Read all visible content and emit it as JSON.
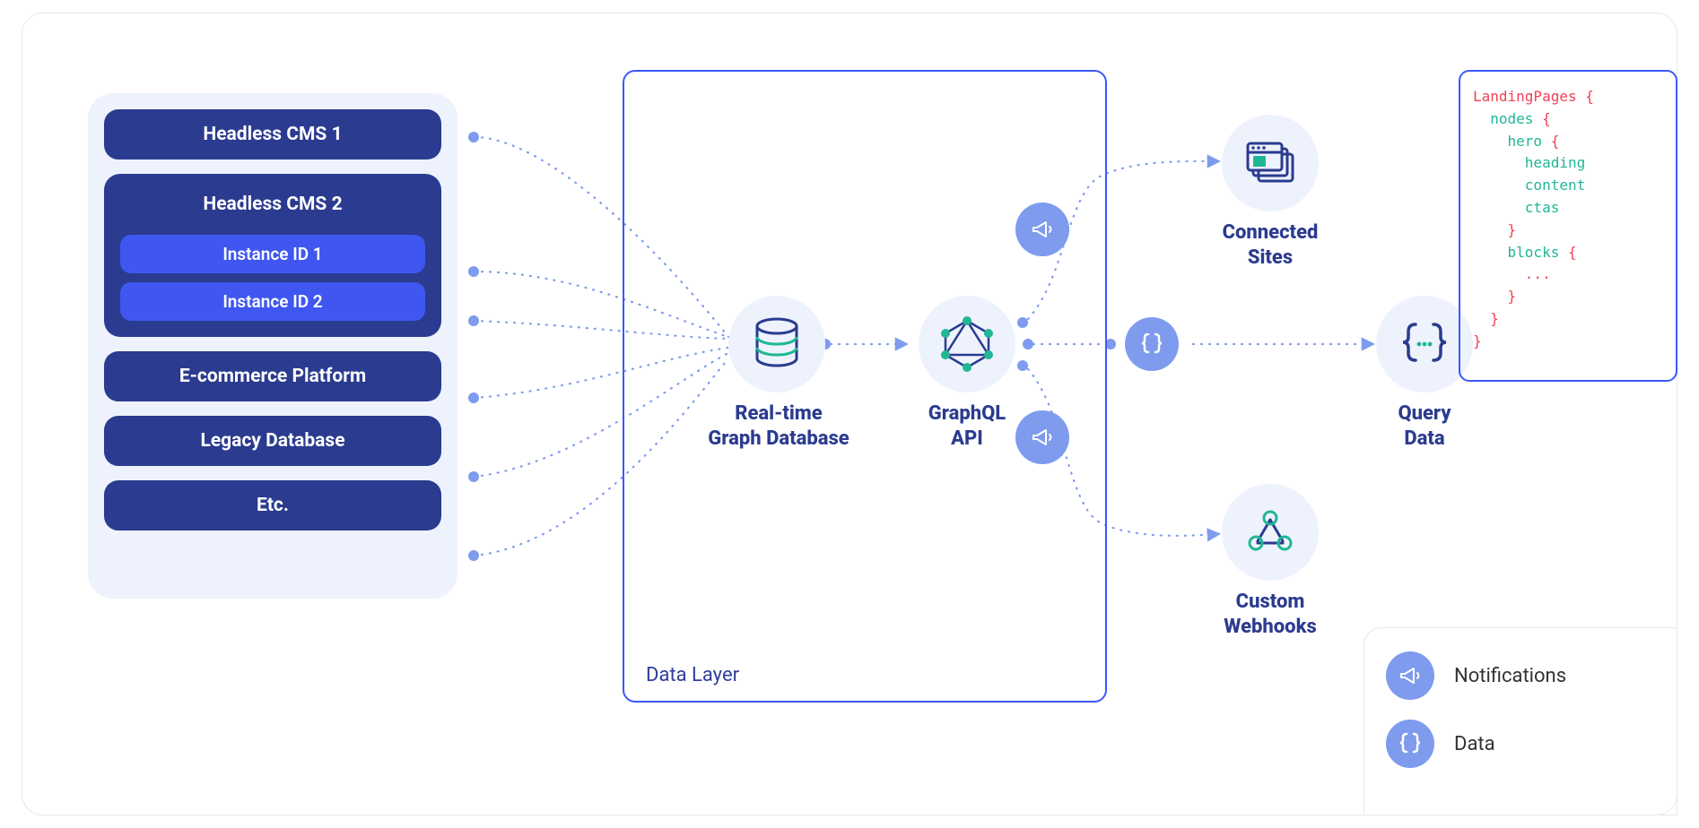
{
  "sources": {
    "items": [
      {
        "label": "Headless CMS 1"
      }
    ],
    "group": {
      "title": "Headless CMS 2",
      "instances": [
        {
          "label": "Instance ID 1"
        },
        {
          "label": "Instance ID 2"
        }
      ]
    },
    "items2": [
      {
        "label": "E-commerce Platform"
      },
      {
        "label": "Legacy Database"
      },
      {
        "label": "Etc."
      }
    ]
  },
  "data_layer": {
    "label": "Data Layer",
    "database": {
      "label_line1": "Real-time",
      "label_line2": "Graph Database"
    },
    "graphql": {
      "label_line1": "GraphQL",
      "label_line2": "API"
    }
  },
  "outputs": {
    "connected_sites": {
      "label_line1": "Connected",
      "label_line2": "Sites"
    },
    "query_data": {
      "label_line1": "Query",
      "label_line2": "Data"
    },
    "custom_webhooks": {
      "label_line1": "Custom",
      "label_line2": "Webhooks"
    }
  },
  "legend": {
    "notifications": "Notifications",
    "data": "Data"
  },
  "code": {
    "l1_a": "LandingPages ",
    "l1_b": "{",
    "l2_a": "nodes ",
    "l2_b": "{",
    "l3_a": "hero ",
    "l3_b": "{",
    "l4": "heading",
    "l5": "content",
    "l6": "ctas",
    "l7": "}",
    "l8_a": "blocks ",
    "l8_b": "{",
    "l9": "...",
    "l10": "}",
    "l11": "}",
    "l12": "}"
  }
}
